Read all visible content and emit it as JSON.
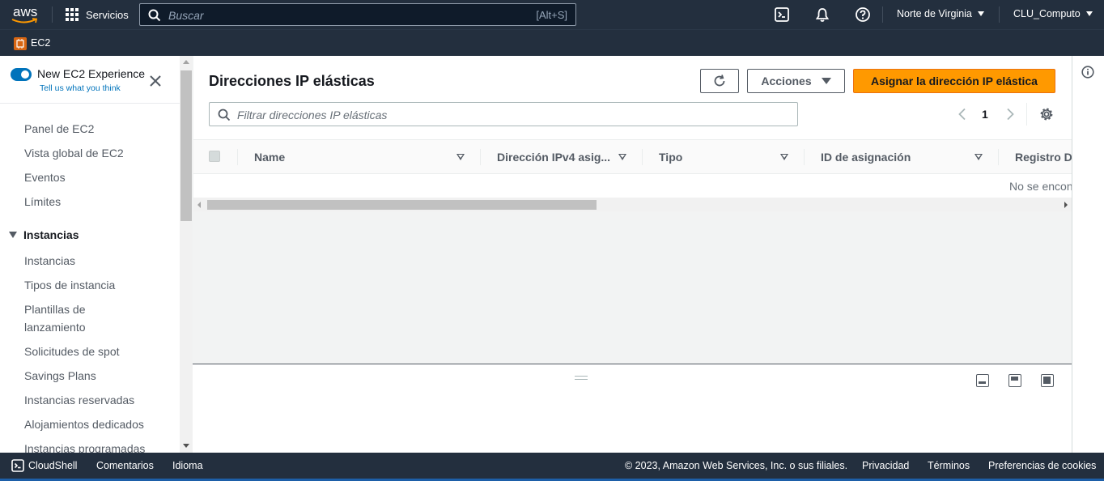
{
  "topnav": {
    "logo_text": "aws",
    "services_label": "Servicios",
    "search_placeholder": "Buscar",
    "search_shortcut": "[Alt+S]",
    "icons": [
      "cloudshell-icon",
      "bell-icon",
      "help-icon"
    ],
    "region": "Norte de Virginia",
    "account": "CLU_Computo"
  },
  "subnav": {
    "service_label": "EC2"
  },
  "sidebar": {
    "toggle_title": "New EC2 Experience",
    "toggle_subtitle": "Tell us what you think",
    "toggle_on": true,
    "items_top": [
      "Panel de EC2",
      "Vista global de EC2",
      "Eventos",
      "Límites"
    ],
    "section_title": "Instancias",
    "section_items": [
      "Instancias",
      "Tipos de instancia",
      "Plantillas de lanzamiento",
      "Solicitudes de spot",
      "Savings Plans",
      "Instancias reservadas",
      "Alojamientos dedicados",
      "Instancias programadas"
    ]
  },
  "main": {
    "title": "Direcciones IP elásticas",
    "actions_label": "Acciones",
    "primary_label": "Asignar la dirección IP elástica",
    "filter_placeholder": "Filtrar direcciones IP elásticas",
    "current_page": "1",
    "columns": [
      "Name",
      "Dirección IPv4 asig...",
      "Tipo",
      "ID de asignación",
      "Registro DI"
    ],
    "empty_text": "No se encon"
  },
  "footer": {
    "cloudshell": "CloudShell",
    "comments": "Comentarios",
    "language": "Idioma",
    "copyright": "© 2023, Amazon Web Services, Inc. o sus filiales.",
    "privacy": "Privacidad",
    "terms": "Términos",
    "cookies": "Preferencias de cookies"
  },
  "colors": {
    "nav_bg": "#232f3e",
    "primary": "#ff9900",
    "link": "#0073bb",
    "service_badge": "#d86613"
  }
}
